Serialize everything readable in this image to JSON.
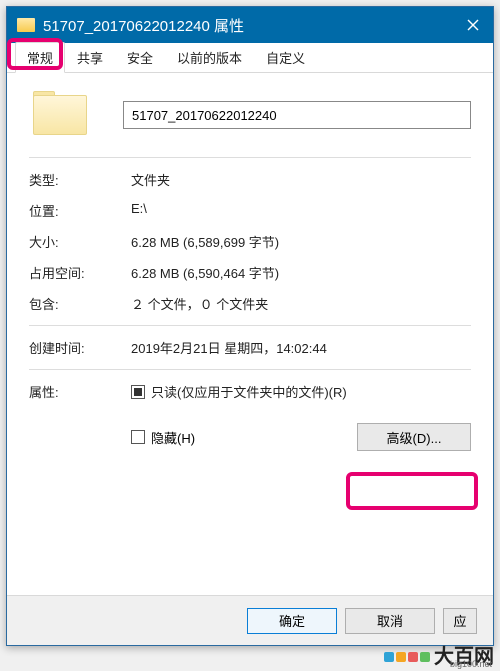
{
  "window": {
    "title": "51707_20170622012240 属性"
  },
  "tabs": {
    "general": "常规",
    "sharing": "共享",
    "security": "安全",
    "previous": "以前的版本",
    "custom": "自定义"
  },
  "folder": {
    "name": "51707_20170622012240"
  },
  "labels": {
    "type": "类型:",
    "location": "位置:",
    "size": "大小:",
    "size_on_disk": "占用空间:",
    "contains": "包含:",
    "created": "创建时间:",
    "attributes": "属性:"
  },
  "values": {
    "type": "文件夹",
    "location": "E:\\",
    "size": "6.28 MB (6,589,699 字节)",
    "size_on_disk": "6.28 MB (6,590,464 字节)",
    "contains": "２ 个文件，０ 个文件夹",
    "created": "2019年2月21日 星期四，14:02:44"
  },
  "attributes": {
    "readonly_label": "只读(仅应用于文件夹中的文件)(R)",
    "hidden_label": "隐藏(H)",
    "advanced_btn": "高级(D)..."
  },
  "buttons": {
    "ok": "确定",
    "cancel": "取消",
    "apply": "应"
  },
  "watermark": {
    "brand": "大百网",
    "url": "big100.net"
  }
}
